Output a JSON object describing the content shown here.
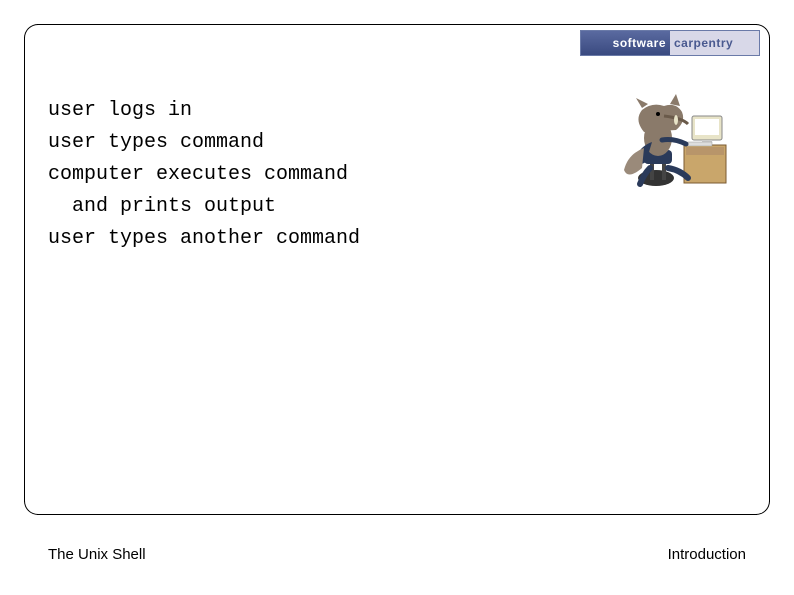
{
  "logo": {
    "left": "software",
    "right": "carpentry"
  },
  "lines": {
    "l1": "user logs in",
    "l2": "user types command",
    "l3": "computer executes command",
    "l4": "and prints output",
    "l5": "user types another command"
  },
  "footer": {
    "left": "The Unix Shell",
    "right": "Introduction"
  }
}
